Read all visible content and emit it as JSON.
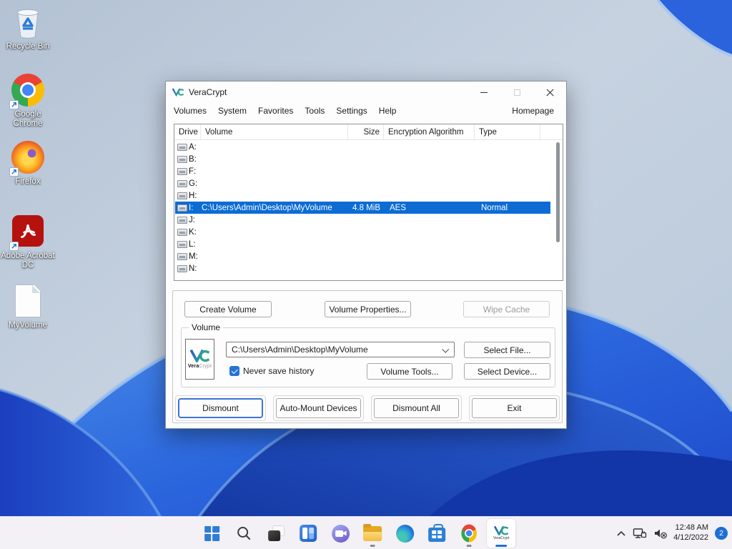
{
  "desktop": {
    "icons": [
      {
        "label": "Recycle Bin"
      },
      {
        "label": "Google Chrome"
      },
      {
        "label": "Firefox"
      },
      {
        "label": "Adobe Acrobat DC"
      },
      {
        "label": "MyVolume"
      }
    ]
  },
  "window": {
    "title": "VeraCrypt",
    "menu": {
      "items": [
        "Volumes",
        "System",
        "Favorites",
        "Tools",
        "Settings",
        "Help"
      ],
      "right": "Homepage"
    },
    "table": {
      "columns": [
        "Drive",
        "Volume",
        "Size",
        "Encryption Algorithm",
        "Type"
      ],
      "rows": [
        {
          "drive": "A:",
          "volume": "",
          "size": "",
          "algorithm": "",
          "type": "",
          "selected": false
        },
        {
          "drive": "B:",
          "volume": "",
          "size": "",
          "algorithm": "",
          "type": "",
          "selected": false
        },
        {
          "drive": "F:",
          "volume": "",
          "size": "",
          "algorithm": "",
          "type": "",
          "selected": false
        },
        {
          "drive": "G:",
          "volume": "",
          "size": "",
          "algorithm": "",
          "type": "",
          "selected": false
        },
        {
          "drive": "H:",
          "volume": "",
          "size": "",
          "algorithm": "",
          "type": "",
          "selected": false
        },
        {
          "drive": "I:",
          "volume": "C:\\Users\\Admin\\Desktop\\MyVolume",
          "size": "4.8 MiB",
          "algorithm": "AES",
          "type": "Normal",
          "selected": true
        },
        {
          "drive": "J:",
          "volume": "",
          "size": "",
          "algorithm": "",
          "type": "",
          "selected": false
        },
        {
          "drive": "K:",
          "volume": "",
          "size": "",
          "algorithm": "",
          "type": "",
          "selected": false
        },
        {
          "drive": "L:",
          "volume": "",
          "size": "",
          "algorithm": "",
          "type": "",
          "selected": false
        },
        {
          "drive": "M:",
          "volume": "",
          "size": "",
          "algorithm": "",
          "type": "",
          "selected": false
        },
        {
          "drive": "N:",
          "volume": "",
          "size": "",
          "algorithm": "",
          "type": "",
          "selected": false
        }
      ]
    },
    "actions": {
      "create_volume": "Create Volume",
      "volume_properties": "Volume Properties...",
      "wipe_cache": "Wipe Cache"
    },
    "volume": {
      "group_label": "Volume",
      "logo_bold": "Vera",
      "logo_light": "Crypt",
      "path_value": "C:\\Users\\Admin\\Desktop\\MyVolume",
      "select_file": "Select File...",
      "checkbox_label": "Never save history",
      "checkbox_checked": true,
      "volume_tools": "Volume Tools...",
      "select_device": "Select Device..."
    },
    "footer_buttons": [
      {
        "label": "Dismount",
        "focused": true
      },
      {
        "label": "Auto-Mount Devices",
        "focused": false
      },
      {
        "label": "Dismount All",
        "focused": false
      },
      {
        "label": "Exit",
        "focused": false
      }
    ]
  },
  "taskbar": {
    "veracrypt_tile_label": "VeraCrypt",
    "tray": {
      "time": "12:48 AM",
      "date": "4/12/2022",
      "badge": "2"
    }
  },
  "colors": {
    "selection": "#0c6cd4",
    "accent": "#1f6fd4",
    "taskbar": "#f3f1f6",
    "wallpaper_blue": "#2b66dd"
  }
}
